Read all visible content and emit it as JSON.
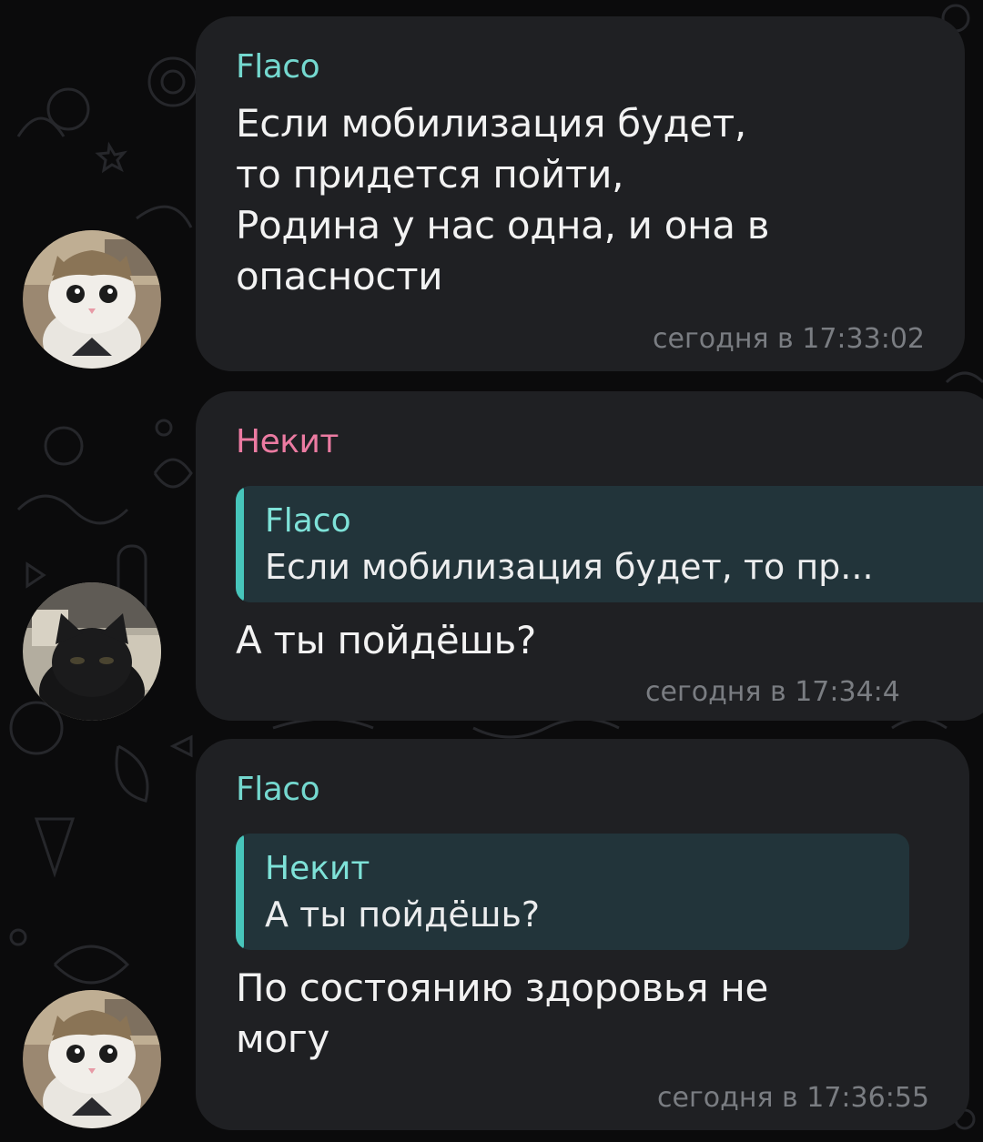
{
  "chat": {
    "messages": [
      {
        "sender": "Flaco",
        "text": "Если мобилизация будет,\nто придется пойти,\nРодина у нас одна, и она в\nопасности",
        "time": "сегодня в 17:33:02"
      },
      {
        "sender": "Некит",
        "reply": {
          "sender": "Flaco",
          "text": "Если мобилизация будет, то пр..."
        },
        "text": "А ты пойдёшь?",
        "time": "сегодня в 17:34:4"
      },
      {
        "sender": "Flaco",
        "reply": {
          "sender": "Некит",
          "text": "А ты пойдёшь?"
        },
        "text": "По состоянию здоровья не\nмогу",
        "time": "сегодня в 17:36:55"
      }
    ]
  },
  "colors": {
    "background": "#0b0b0c",
    "bubble": "#1f2023",
    "flaco_name": "#74d8cf",
    "nekit_name": "#ec7ba2",
    "reply_bar": "#47c5bb",
    "timestamp": "#7a7d82"
  },
  "icons": {
    "flaco_avatar": "cat-photo-avatar",
    "nekit_avatar": "black-cat-photo-avatar"
  }
}
